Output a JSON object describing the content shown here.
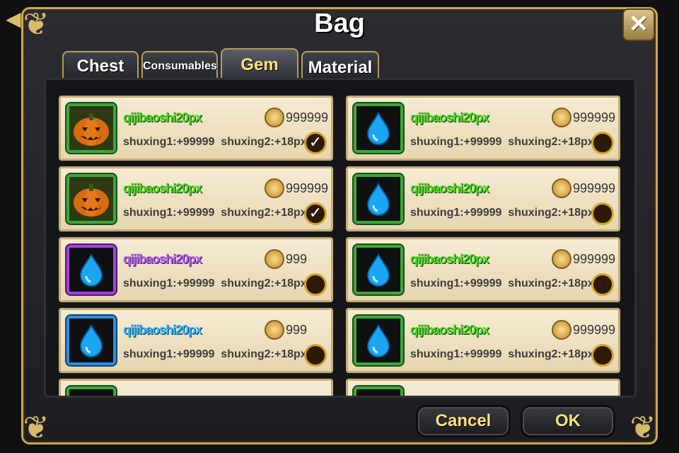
{
  "title": "Bag",
  "close_label": "✕",
  "tabs": [
    {
      "label": "Chest"
    },
    {
      "label": "Consumables"
    },
    {
      "label": "Gem",
      "active": true
    },
    {
      "label": "Material"
    }
  ],
  "items": [
    {
      "icon": "pumpkin-icon",
      "rarity": "green",
      "name": "qijibaoshi20px",
      "price": "999999",
      "attr1": "shuxing1:+99999",
      "attr2": "shuxing2:+18px",
      "checked": true
    },
    {
      "icon": "water-drop-icon",
      "rarity": "green",
      "name": "qijibaoshi20px",
      "price": "999999",
      "attr1": "shuxing1:+99999",
      "attr2": "shuxing2:+18px",
      "checked": false
    },
    {
      "icon": "pumpkin-icon",
      "rarity": "green",
      "name": "qijibaoshi20px",
      "price": "999999",
      "attr1": "shuxing1:+99999",
      "attr2": "shuxing2:+18px",
      "checked": true
    },
    {
      "icon": "water-drop-icon",
      "rarity": "green",
      "name": "qijibaoshi20px",
      "price": "999999",
      "attr1": "shuxing1:+99999",
      "attr2": "shuxing2:+18px",
      "checked": false
    },
    {
      "icon": "water-drop-icon",
      "rarity": "purple",
      "name": "qijibaoshi20px",
      "price": "999",
      "attr1": "shuxing1:+99999",
      "attr2": "shuxing2:+18px",
      "checked": false
    },
    {
      "icon": "water-drop-icon",
      "rarity": "green",
      "name": "qijibaoshi20px",
      "price": "999999",
      "attr1": "shuxing1:+99999",
      "attr2": "shuxing2:+18px",
      "checked": false
    },
    {
      "icon": "water-drop-icon",
      "rarity": "blue",
      "name": "qijibaoshi20px",
      "price": "999",
      "attr1": "shuxing1:+99999",
      "attr2": "shuxing2:+18px",
      "checked": false
    },
    {
      "icon": "water-drop-icon",
      "rarity": "green",
      "name": "qijibaoshi20px",
      "price": "999999",
      "attr1": "shuxing1:+99999",
      "attr2": "shuxing2:+18px",
      "checked": false
    }
  ],
  "buttons": {
    "cancel": "Cancel",
    "ok": "OK"
  },
  "colors": {
    "frame_gold": "#c9a85a",
    "green_name": "#4ad91d",
    "purple_name": "#b35df0",
    "blue_name": "#2fb7ff",
    "button_text": "#ffe27a"
  }
}
